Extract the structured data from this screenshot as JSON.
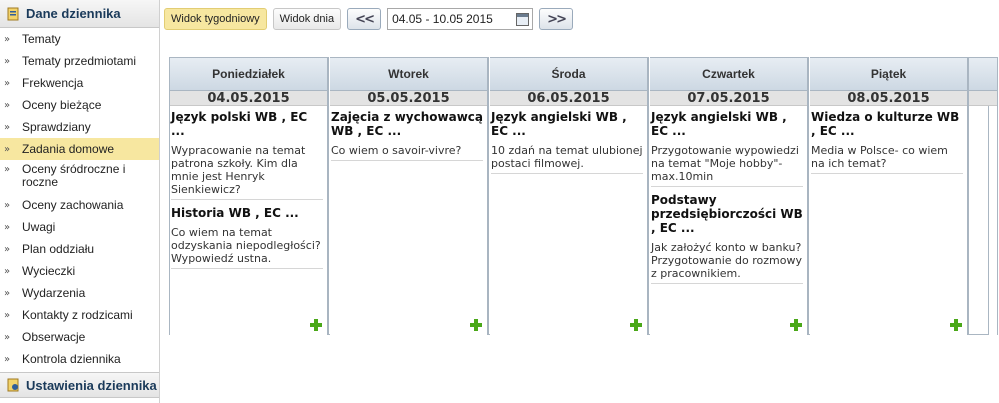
{
  "sidebar": {
    "header": "Dane dziennika",
    "items": [
      {
        "label": "Tematy",
        "active": false
      },
      {
        "label": "Tematy przedmiotami",
        "active": false
      },
      {
        "label": "Frekwencja",
        "active": false
      },
      {
        "label": "Oceny bieżące",
        "active": false
      },
      {
        "label": "Sprawdziany",
        "active": false
      },
      {
        "label": "Zadania domowe",
        "active": true
      },
      {
        "label": "Oceny śródroczne i roczne",
        "active": false
      },
      {
        "label": "Oceny zachowania",
        "active": false
      },
      {
        "label": "Uwagi",
        "active": false
      },
      {
        "label": "Plan oddziału",
        "active": false
      },
      {
        "label": "Wycieczki",
        "active": false
      },
      {
        "label": "Wydarzenia",
        "active": false
      },
      {
        "label": "Kontakty z rodzicami",
        "active": false
      },
      {
        "label": "Obserwacje",
        "active": false
      },
      {
        "label": "Kontrola dziennika",
        "active": false
      }
    ],
    "footer": "Ustawienia dziennika"
  },
  "toolbar": {
    "weekly_view": "Widok tygodniowy",
    "daily_view": "Widok dnia",
    "date_range": "04.05 - 10.05 2015"
  },
  "calendar": {
    "days": [
      {
        "name": "Poniedziałek",
        "date": "04.05.2015",
        "entries": [
          {
            "title": "Język polski WB , EC ...",
            "desc": "Wypracowanie na temat patrona szkoły. Kim dla mnie jest Henryk Sienkiewicz?"
          },
          {
            "title": "Historia WB , EC ...",
            "desc": "Co wiem na temat odzyskania niepodległości? Wypowiedź ustna."
          }
        ]
      },
      {
        "name": "Wtorek",
        "date": "05.05.2015",
        "entries": [
          {
            "title": "Zajęcia z wychowawcą WB , EC ...",
            "desc": "Co wiem o savoir-vivre?"
          }
        ]
      },
      {
        "name": "Środa",
        "date": "06.05.2015",
        "entries": [
          {
            "title": "Język angielski WB , EC ...",
            "desc": "10 zdań na temat ulubionej postaci filmowej."
          }
        ]
      },
      {
        "name": "Czwartek",
        "date": "07.05.2015",
        "entries": [
          {
            "title": "Język angielski WB , EC ...",
            "desc": "Przygotowanie wypowiedzi na temat \"Moje hobby\"- max.10min"
          },
          {
            "title": "Podstawy przedsiębiorczości WB , EC ...",
            "desc": "Jak założyć konto w banku? Przygotowanie do rozmowy z pracownikiem."
          }
        ]
      },
      {
        "name": "Piątek",
        "date": "08.05.2015",
        "entries": [
          {
            "title": "Wiedza o kulturze WB , EC ...",
            "desc": "Media w Polsce- co wiem na ich temat?"
          }
        ]
      }
    ]
  },
  "colors": {
    "active_highlight": "#f7e7a0",
    "add_icon": "#4aa818",
    "header_text": "#1a3a5a"
  }
}
